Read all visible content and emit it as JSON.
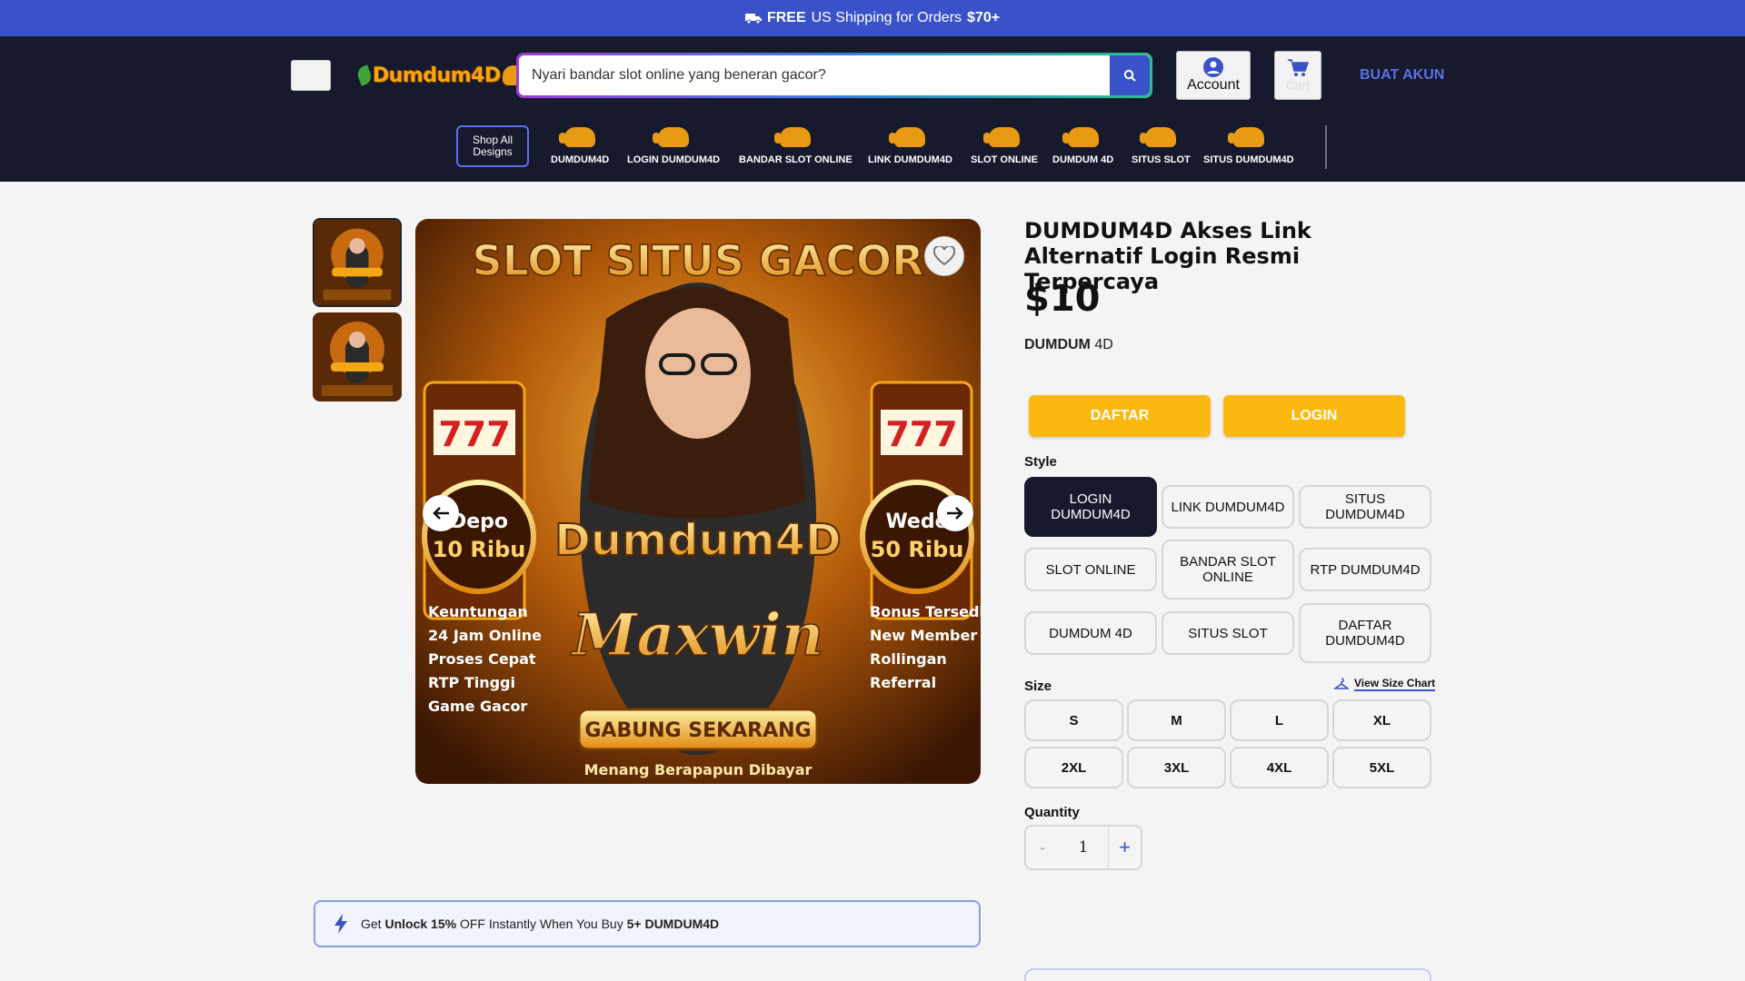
{
  "promo_bar": {
    "free": "FREE",
    "text": "US Shipping for Orders",
    "amount": "$70+"
  },
  "header": {
    "logo_text": "Dumdum4D",
    "search_placeholder": "Nyari bandar slot online yang beneran gacor?",
    "account_label": "Account",
    "cart_label": "Cart",
    "signup_label": "BUAT AKUN"
  },
  "nav": {
    "shop_all": "Shop All Designs",
    "items": [
      "DUMDUM4D",
      "LOGIN DUMDUM4D",
      "BANDAR SLOT ONLINE",
      "LINK DUMDUM4D",
      "SLOT ONLINE",
      "DUMDUM 4D",
      "SITUS SLOT",
      "SITUS DUMDUM4D"
    ]
  },
  "gallery": {
    "banner_title": "SLOT SITUS GACOR",
    "brand_text": "Dumdum4D",
    "left_badge": [
      "Depo",
      "10 Ribu"
    ],
    "right_badge": [
      "Wede",
      "50 Ribu"
    ],
    "left_list": [
      "Keuntungan",
      "24 Jam Online",
      "Proses Cepat",
      "RTP Tinggi",
      "Game Gacor"
    ],
    "right_list": [
      "Bonus Tersedia",
      "New Member",
      "Rollingan",
      "Referral"
    ],
    "script_text": "Maxwin",
    "cta": "GABUNG SEKARANG",
    "footer": "Menang Berapapun Dibayar"
  },
  "promo_box": {
    "pre": "Get",
    "highlight": "Unlock 15%",
    "mid": "OFF Instantly When You Buy",
    "bold_end": "5+ DUMDUM4D"
  },
  "product": {
    "title": "DUMDUM4D Akses Link Alternatif Login Resmi Terpercaya",
    "price": "$10",
    "brand_bold": "DUMDUM",
    "brand_rest": " 4D",
    "cta_register": "DAFTAR",
    "cta_login": "LOGIN",
    "style_label": "Style",
    "styles": [
      "LOGIN DUMDUM4D",
      "LINK DUMDUM4D",
      "SITUS DUMDUM4D",
      "SLOT ONLINE",
      "BANDAR SLOT ONLINE",
      "RTP DUMDUM4D",
      "DUMDUM 4D",
      "SITUS SLOT",
      "DAFTAR DUMDUM4D"
    ],
    "size_label": "Size",
    "size_chart": "View Size Chart",
    "sizes": [
      "S",
      "M",
      "L",
      "XL",
      "2XL",
      "3XL",
      "4XL",
      "5XL"
    ],
    "quantity_label": "Quantity",
    "quantity": "1",
    "minus": "-",
    "plus": "+"
  },
  "colors": {
    "accent": "#3a52c9",
    "header_bg": "#161a2c",
    "cta": "#fbb811"
  }
}
